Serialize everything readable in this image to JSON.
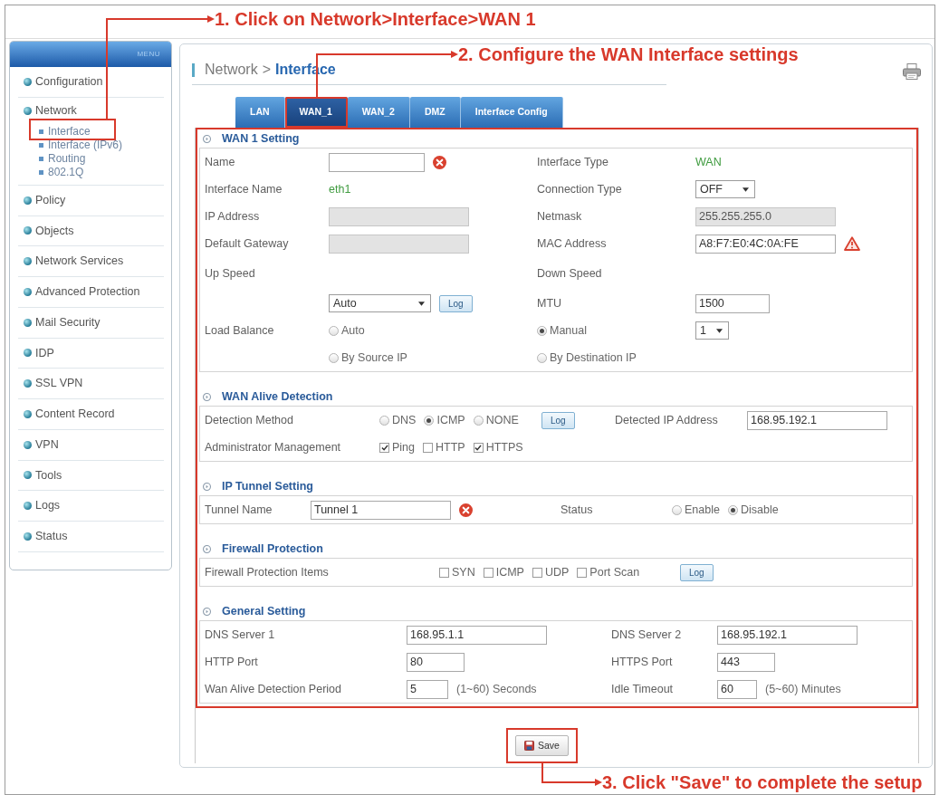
{
  "annotations": [
    {
      "text": "1. Click on Network>Interface>WAN 1"
    },
    {
      "text": "2. Configure the WAN Interface settings"
    },
    {
      "text": "3. Click \"Save\" to complete the setup"
    }
  ],
  "sidebar": {
    "header": "MENU",
    "items": [
      {
        "label": "Configuration",
        "highlighted": false
      },
      {
        "label": "Network",
        "highlighted": false,
        "children": [
          {
            "label": "Interface",
            "highlighted": true
          },
          {
            "label": "Interface (IPv6)",
            "highlighted": false
          },
          {
            "label": "Routing",
            "highlighted": false
          },
          {
            "label": "802.1Q",
            "highlighted": false
          }
        ]
      },
      {
        "label": "Policy",
        "highlighted": false
      },
      {
        "label": "Objects",
        "highlighted": false
      },
      {
        "label": "Network Services",
        "highlighted": false
      },
      {
        "label": "Advanced Protection",
        "highlighted": false
      },
      {
        "label": "Mail Security",
        "highlighted": false
      },
      {
        "label": "IDP",
        "highlighted": false
      },
      {
        "label": "SSL VPN",
        "highlighted": false
      },
      {
        "label": "Content Record",
        "highlighted": false
      },
      {
        "label": "VPN",
        "highlighted": false
      },
      {
        "label": "Tools",
        "highlighted": false
      },
      {
        "label": "Logs",
        "highlighted": false
      },
      {
        "label": "Status",
        "highlighted": false
      }
    ]
  },
  "breadcrumb": {
    "separator": ">",
    "items": [
      {
        "label": "Network",
        "current": false
      },
      {
        "label": "Interface",
        "current": true
      }
    ]
  },
  "tabs": [
    {
      "label": "LAN",
      "selected": false,
      "highlighted": false
    },
    {
      "label": "WAN_1",
      "selected": true,
      "highlighted": true
    },
    {
      "label": "WAN_2",
      "selected": false,
      "highlighted": false
    },
    {
      "label": "DMZ",
      "selected": false,
      "highlighted": false
    },
    {
      "label": "Interface Config",
      "selected": false,
      "highlighted": false
    }
  ],
  "settings": {
    "highlighted": true,
    "sections": [
      {
        "title": "WAN 1 Setting",
        "rows": [
          [
            [
              {
                "kind": "label",
                "text": "Name"
              }
            ],
            [
              {
                "kind": "input",
                "disabled": false,
                "invalid": true,
                "warning": false
              }
            ],
            [
              {
                "kind": "label",
                "text": "Interface Type"
              }
            ],
            [
              {
                "kind": "value",
                "text": "WAN"
              }
            ]
          ],
          [
            [
              {
                "kind": "label",
                "text": "Interface Name"
              }
            ],
            [
              {
                "kind": "value",
                "text": "eth1"
              }
            ],
            [
              {
                "kind": "label",
                "text": "Connection Type"
              }
            ],
            [
              {
                "kind": "select",
                "value": "OFF"
              }
            ]
          ],
          [
            [
              {
                "kind": "label",
                "text": "IP Address"
              }
            ],
            [
              {
                "kind": "input",
                "disabled": true,
                "invalid": false,
                "warning": false
              }
            ],
            [
              {
                "kind": "label",
                "text": "Netmask"
              }
            ],
            [
              {
                "kind": "input",
                "value": "255.255.255.0",
                "disabled": true,
                "invalid": false,
                "warning": false
              }
            ]
          ],
          [
            [
              {
                "kind": "label",
                "text": "Default Gateway"
              }
            ],
            [
              {
                "kind": "input",
                "disabled": true,
                "invalid": false,
                "warning": false
              }
            ],
            [
              {
                "kind": "label",
                "text": "MAC Address"
              }
            ],
            [
              {
                "kind": "input",
                "value": "A8:F7:E0:4C:0A:FE",
                "disabled": false,
                "invalid": false,
                "warning": true
              }
            ]
          ],
          [
            [
              {
                "kind": "label",
                "text": "Up Speed"
              }
            ],
            null,
            [
              {
                "kind": "label",
                "text": "Down Speed"
              }
            ]
          ],
          [
            null,
            [
              {
                "kind": "select",
                "value": "Auto"
              },
              {
                "kind": "button",
                "label": "Log"
              }
            ],
            [
              {
                "kind": "label",
                "text": "MTU"
              }
            ],
            [
              {
                "kind": "input",
                "value": "1500",
                "disabled": false,
                "invalid": false,
                "warning": false
              }
            ]
          ],
          [
            [
              {
                "kind": "label",
                "text": "Load Balance"
              }
            ],
            [
              {
                "kind": "radio",
                "label": "Auto",
                "selected": false
              }
            ],
            [
              {
                "kind": "radio",
                "label": "Manual",
                "selected": true
              }
            ],
            [
              {
                "kind": "select",
                "value": "1"
              }
            ]
          ],
          [
            null,
            [
              {
                "kind": "radio",
                "label": "By Source IP",
                "selected": false
              }
            ],
            [
              {
                "kind": "radio",
                "label": "By Destination IP",
                "selected": false
              }
            ]
          ]
        ]
      },
      {
        "title": "WAN Alive Detection",
        "rows": [
          [
            [
              {
                "kind": "label",
                "text": "Detection Method"
              }
            ],
            [
              {
                "kind": "radio",
                "label": "DNS",
                "selected": false
              },
              {
                "kind": "radio",
                "label": "ICMP",
                "selected": true
              },
              {
                "kind": "radio",
                "label": "NONE",
                "selected": false
              }
            ],
            [
              {
                "kind": "button",
                "label": "Log"
              }
            ],
            [
              {
                "kind": "label",
                "text": "Detected IP Address"
              }
            ],
            [
              {
                "kind": "input",
                "value": "168.95.192.1",
                "disabled": false,
                "invalid": false,
                "warning": false
              }
            ]
          ],
          [
            [
              {
                "kind": "label",
                "text": "Administrator Management"
              }
            ],
            [
              {
                "kind": "checkbox",
                "label": "Ping",
                "checked": true
              },
              {
                "kind": "checkbox",
                "label": "HTTP",
                "checked": false
              },
              {
                "kind": "checkbox",
                "label": "HTTPS",
                "checked": true
              }
            ]
          ]
        ]
      },
      {
        "title": "IP Tunnel Setting",
        "rows": [
          [
            [
              {
                "kind": "label",
                "text": "Tunnel Name"
              }
            ],
            [
              {
                "kind": "input",
                "value": "Tunnel 1",
                "disabled": false,
                "invalid": true,
                "warning": false
              }
            ],
            [
              {
                "kind": "label",
                "text": "Status"
              }
            ],
            [
              {
                "kind": "radio",
                "label": "Enable",
                "selected": false
              },
              {
                "kind": "radio",
                "label": "Disable",
                "selected": true
              }
            ]
          ]
        ]
      },
      {
        "title": "Firewall Protection",
        "rows": [
          [
            [
              {
                "kind": "label",
                "text": "Firewall Protection Items"
              }
            ],
            [
              {
                "kind": "checkbox",
                "label": "SYN",
                "checked": false
              },
              {
                "kind": "checkbox",
                "label": "ICMP",
                "checked": false
              },
              {
                "kind": "checkbox",
                "label": "UDP",
                "checked": false
              },
              {
                "kind": "checkbox",
                "label": "Port Scan",
                "checked": false
              }
            ],
            [
              {
                "kind": "button",
                "label": "Log"
              }
            ]
          ]
        ]
      },
      {
        "title": "General Setting",
        "rows": [
          [
            [
              {
                "kind": "label",
                "text": "DNS Server 1"
              }
            ],
            [
              {
                "kind": "input",
                "value": "168.95.1.1",
                "disabled": false,
                "invalid": false,
                "warning": false
              }
            ],
            [
              {
                "kind": "label",
                "text": "DNS Server 2"
              }
            ],
            [
              {
                "kind": "input",
                "value": "168.95.192.1",
                "disabled": false,
                "invalid": false,
                "warning": false
              }
            ]
          ],
          [
            [
              {
                "kind": "label",
                "text": "HTTP Port"
              }
            ],
            [
              {
                "kind": "input",
                "value": "80",
                "disabled": false,
                "invalid": false,
                "warning": false
              }
            ],
            [
              {
                "kind": "label",
                "text": "HTTPS Port"
              }
            ],
            [
              {
                "kind": "input",
                "value": "443",
                "disabled": false,
                "invalid": false,
                "warning": false
              }
            ]
          ],
          [
            [
              {
                "kind": "label",
                "text": "Wan Alive Detection Period"
              }
            ],
            [
              {
                "kind": "input",
                "value": "5",
                "disabled": false,
                "invalid": false,
                "warning": false
              },
              {
                "kind": "note",
                "text": "(1~60) Seconds"
              }
            ],
            [
              {
                "kind": "label",
                "text": "Idle Timeout"
              }
            ],
            [
              {
                "kind": "input",
                "value": "60",
                "disabled": false,
                "invalid": false,
                "warning": false
              },
              {
                "kind": "note",
                "text": "(5~60) Minutes"
              }
            ]
          ]
        ]
      }
    ]
  },
  "save_button": {
    "label": "Save",
    "highlighted": true
  }
}
